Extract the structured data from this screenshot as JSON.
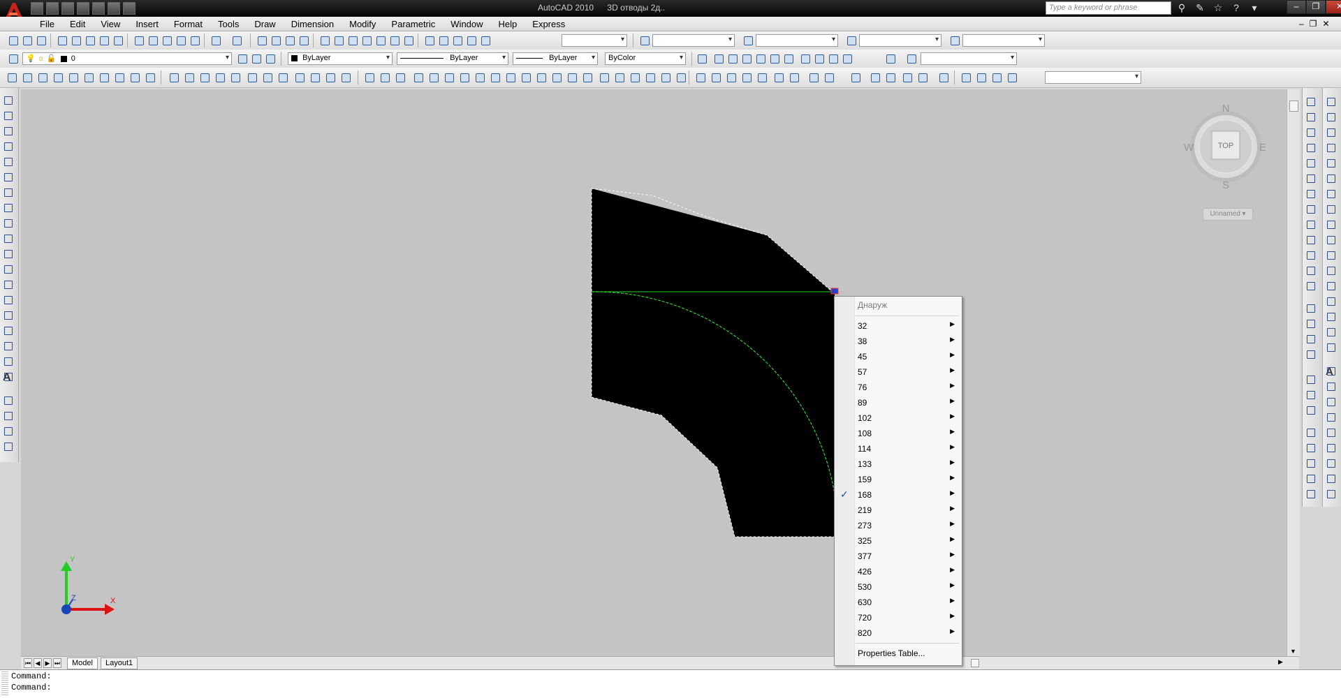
{
  "titlebar": {
    "app_name": "AutoCAD 2010",
    "doc_name": "3D отводы 2д..",
    "search_placeholder": "Type a keyword or phrase"
  },
  "menu": [
    "File",
    "Edit",
    "View",
    "Insert",
    "Format",
    "Tools",
    "Draw",
    "Dimension",
    "Modify",
    "Parametric",
    "Window",
    "Help",
    "Express"
  ],
  "layers": {
    "current_layer": "0",
    "color": "ByLayer",
    "linetype": "ByLayer",
    "lineweight": "ByLayer",
    "plotstyle": "ByColor"
  },
  "viewcube": {
    "north": "N",
    "south": "S",
    "east": "E",
    "west": "W",
    "face": "TOP",
    "ucs_name": "Unnamed"
  },
  "ucs_icon": {
    "x_label": "X",
    "y_label": "Y",
    "z_label": "Z"
  },
  "layout_tabs": [
    "Model",
    "Layout1"
  ],
  "context_menu": {
    "title": "Днаруж",
    "items": [
      {
        "label": "32",
        "checked": false
      },
      {
        "label": "38",
        "checked": false
      },
      {
        "label": "45",
        "checked": false
      },
      {
        "label": "57",
        "checked": false
      },
      {
        "label": "76",
        "checked": false
      },
      {
        "label": "89",
        "checked": false
      },
      {
        "label": "102",
        "checked": false
      },
      {
        "label": "108",
        "checked": false
      },
      {
        "label": "114",
        "checked": false
      },
      {
        "label": "133",
        "checked": false
      },
      {
        "label": "159",
        "checked": false
      },
      {
        "label": "168",
        "checked": true
      },
      {
        "label": "219",
        "checked": false
      },
      {
        "label": "273",
        "checked": false
      },
      {
        "label": "325",
        "checked": false
      },
      {
        "label": "377",
        "checked": false
      },
      {
        "label": "426",
        "checked": false
      },
      {
        "label": "530",
        "checked": false
      },
      {
        "label": "630",
        "checked": false
      },
      {
        "label": "720",
        "checked": false
      },
      {
        "label": "820",
        "checked": false
      }
    ],
    "footer": "Properties Table..."
  },
  "command_line": [
    "Command:",
    "Command:"
  ],
  "colors": {
    "canvas": "#c4c4c4",
    "block_fill": "#000000",
    "grip_line": "#22aa22",
    "accent_blue": "#1e4f9a"
  }
}
